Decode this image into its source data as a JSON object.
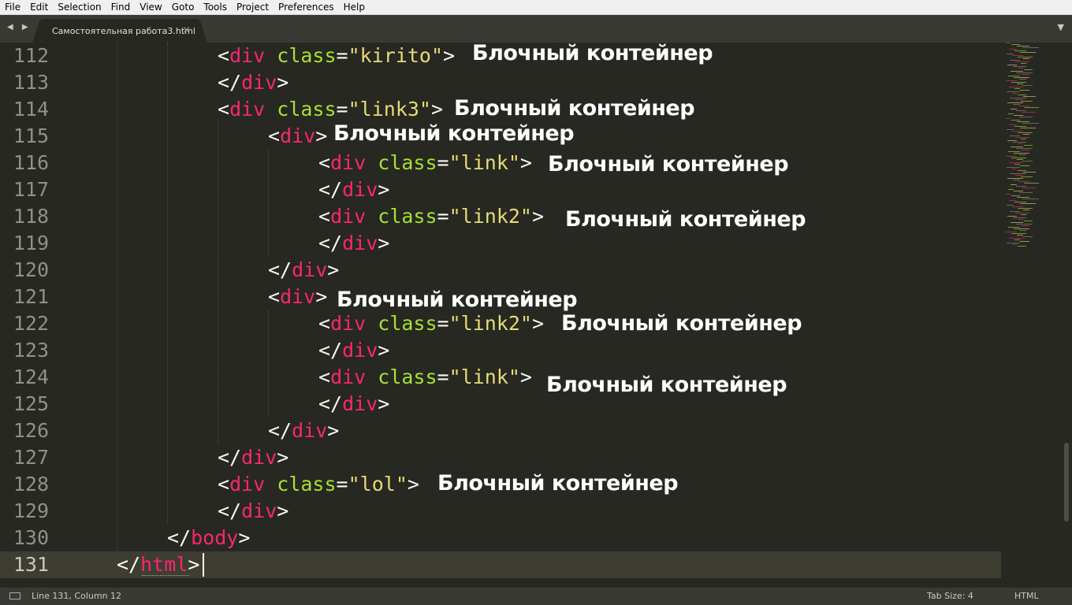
{
  "menu": [
    "File",
    "Edit",
    "Selection",
    "Find",
    "View",
    "Goto",
    "Tools",
    "Project",
    "Preferences",
    "Help"
  ],
  "tabbar": {
    "nav_arrows": "◀ ▶",
    "tab_title": "Самостоятельная работа3.html",
    "close": "×",
    "dropdown": "▼"
  },
  "gutter": {
    "line_numbers": [
      "112",
      "113",
      "114",
      "115",
      "116",
      "117",
      "118",
      "119",
      "120",
      "121",
      "122",
      "123",
      "124",
      "125",
      "126",
      "127",
      "128",
      "129",
      "130",
      "131"
    ],
    "current_line": "131"
  },
  "code": {
    "l112": {
      "open": "<",
      "tag": "div",
      "attr": "class",
      "eq": "=",
      "val": "\"kirito\"",
      "close": ">"
    },
    "l113": {
      "open": "</",
      "tag": "div",
      "close": ">"
    },
    "l114": {
      "open": "<",
      "tag": "div",
      "attr": "class",
      "eq": "=",
      "val": "\"link3\"",
      "close": ">"
    },
    "l115": {
      "open": "<",
      "tag": "div",
      "close": ">"
    },
    "l116": {
      "open": "<",
      "tag": "div",
      "attr": "class",
      "eq": "=",
      "val": "\"link\"",
      "close": ">"
    },
    "l117": {
      "open": "</",
      "tag": "div",
      "close": ">"
    },
    "l118": {
      "open": "<",
      "tag": "div",
      "attr": "class",
      "eq": "=",
      "val": "\"link2\"",
      "close": ">"
    },
    "l119": {
      "open": "</",
      "tag": "div",
      "close": ">"
    },
    "l120": {
      "open": "</",
      "tag": "div",
      "close": ">"
    },
    "l121": {
      "open": "<",
      "tag": "div",
      "close": ">"
    },
    "l122": {
      "open": "<",
      "tag": "div",
      "attr": "class",
      "eq": "=",
      "val": "\"link2\"",
      "close": ">"
    },
    "l123": {
      "open": "</",
      "tag": "div",
      "close": ">"
    },
    "l124": {
      "open": "<",
      "tag": "div",
      "attr": "class",
      "eq": "=",
      "val": "\"link\"",
      "close": ">"
    },
    "l125": {
      "open": "</",
      "tag": "div",
      "close": ">"
    },
    "l126": {
      "open": "</",
      "tag": "div",
      "close": ">"
    },
    "l127": {
      "open": "</",
      "tag": "div",
      "close": ">"
    },
    "l128": {
      "open": "<",
      "tag": "div",
      "attr": "class",
      "eq": "=",
      "val": "\"lol\"",
      "close": ">"
    },
    "l129": {
      "open": "</",
      "tag": "div",
      "close": ">"
    },
    "l130": {
      "open": "</",
      "tag": "body",
      "close": ">"
    },
    "l131": {
      "open": "</",
      "tag": "html",
      "close": ">"
    }
  },
  "annotations": [
    "Блочный контейнер",
    "Блочный контейнер",
    "Блочный контейнер",
    "Блочный контейнер",
    "Блочный контейнер",
    "Блочный контейнер",
    "Блочный контейнер",
    "Блочный контейнер",
    "Блочный контейнер"
  ],
  "status": {
    "position": "Line 131, Column 12",
    "tab_size": "Tab Size: 4",
    "syntax": "HTML"
  },
  "colors": {
    "background": "#272822",
    "tag": "#f92672",
    "attribute": "#a6e22e",
    "string": "#e6db74",
    "text": "#f8f8f2"
  }
}
